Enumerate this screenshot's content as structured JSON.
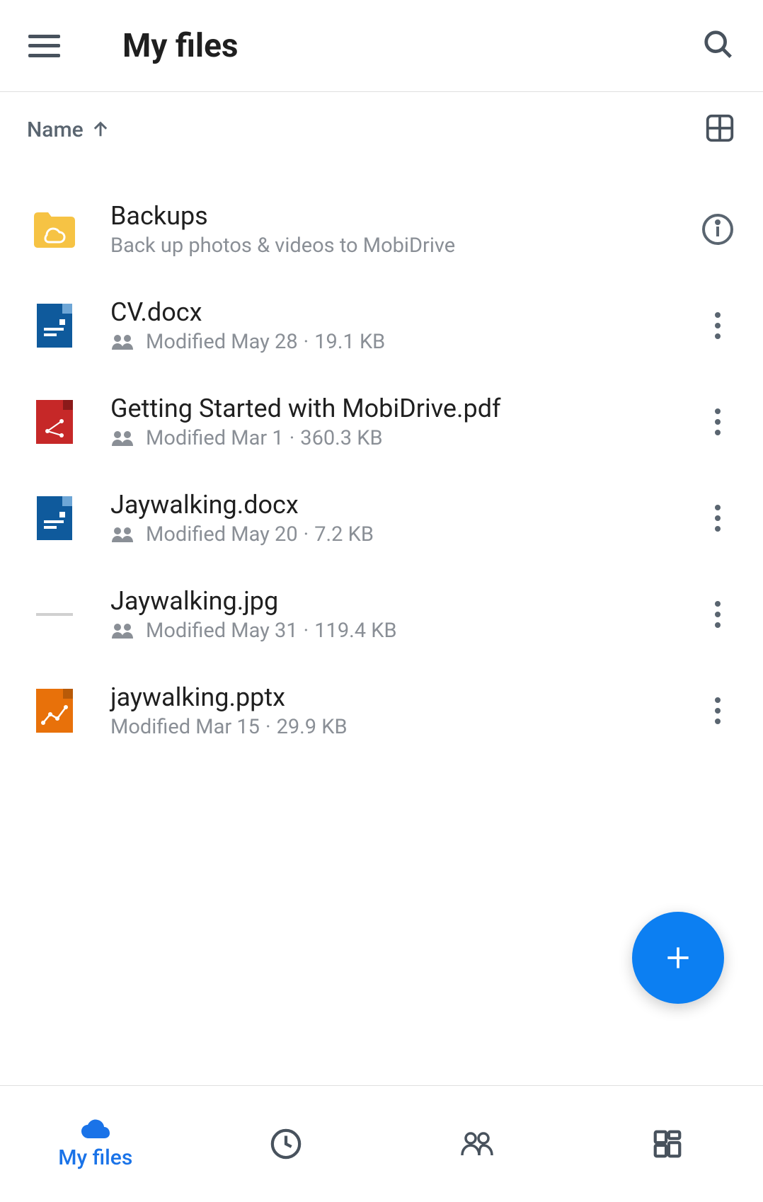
{
  "header": {
    "title": "My files"
  },
  "sort": {
    "label": "Name"
  },
  "files": [
    {
      "name": "Backups",
      "subtitle": "Back up photos & videos to MobiDrive",
      "type": "folder",
      "shared": false,
      "action": "info"
    },
    {
      "name": "CV.docx",
      "modified": "Modified May 28",
      "size": "19.1 KB",
      "type": "docx",
      "shared": true,
      "action": "more"
    },
    {
      "name": "Getting Started with MobiDrive.pdf",
      "modified": "Modified Mar 1",
      "size": "360.3 KB",
      "type": "pdf",
      "shared": true,
      "action": "more"
    },
    {
      "name": "Jaywalking.docx",
      "modified": "Modified May 20",
      "size": "7.2 KB",
      "type": "docx",
      "shared": true,
      "action": "more"
    },
    {
      "name": "Jaywalking.jpg",
      "modified": "Modified May 31",
      "size": "119.4 KB",
      "type": "image",
      "shared": true,
      "action": "more"
    },
    {
      "name": "jaywalking.pptx",
      "modified": "Modified Mar 15",
      "size": "29.9 KB",
      "type": "pptx",
      "shared": false,
      "action": "more"
    }
  ],
  "nav": {
    "myfiles_label": "My files"
  }
}
